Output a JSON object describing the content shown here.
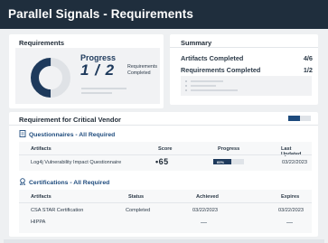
{
  "header": {
    "title": "Parallel Signals - Requirements"
  },
  "requirements": {
    "title": "Requirements",
    "progress_label": "Progress",
    "fraction": "1 / 2",
    "caption_line1": "Requirements",
    "caption_line2": "Completed",
    "progress_value": 0.5,
    "colors": {
      "donut_fill": "#1e3a5c",
      "donut_track": "#dfe2e6"
    }
  },
  "summary": {
    "title": "Summary",
    "rows": [
      {
        "label": "Artifacts Completed",
        "value": "4/6"
      },
      {
        "label": "Requirements Completed",
        "value": "1/2"
      }
    ]
  },
  "vendor": {
    "title": "Requirement for Critical Vendor",
    "questionnaires": {
      "heading": "Questionnaires - All Required",
      "icon": "document-icon",
      "columns": [
        "Artifacts",
        "Score",
        "Progress",
        "Last Updated"
      ],
      "rows": [
        {
          "artifact": "Log4j Vulnerability Impact Questionnaire",
          "score": "65",
          "progress_label": "60%",
          "progress_value": 0.6,
          "last_updated": "03/22/2023"
        }
      ]
    },
    "certifications": {
      "heading": "Certifications - All Required",
      "icon": "certificate-icon",
      "columns": [
        "Artifacts",
        "Status",
        "Achieved",
        "Expires"
      ],
      "rows": [
        {
          "artifact": "CSA STAR Certification",
          "status": "Completed",
          "achieved": "03/22/2023",
          "expires": "03/22/2023"
        },
        {
          "artifact": "HIPPA",
          "status": "",
          "achieved": "",
          "expires": ""
        }
      ]
    }
  }
}
